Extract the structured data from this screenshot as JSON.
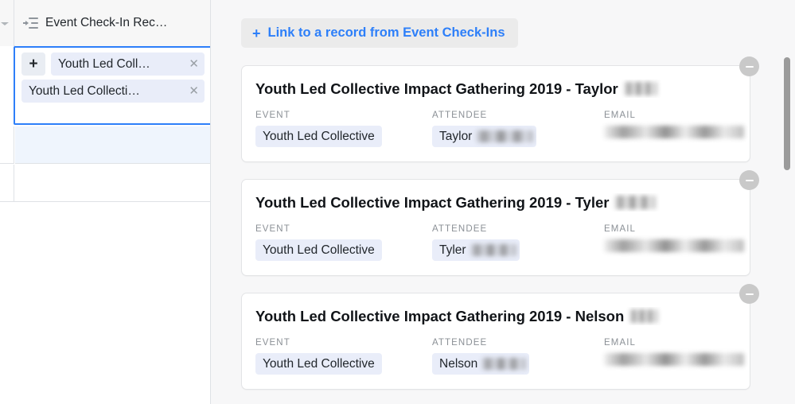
{
  "grid": {
    "column_header": {
      "icon": "linked-record-icon",
      "label": "Event Check-In Rec…"
    },
    "gutter_icon": "chevron-down-icon",
    "selected_cell": {
      "add_button_label": "+",
      "tokens": [
        {
          "label": "Youth Led Coll…",
          "remove_label": "✕"
        },
        {
          "label": "Youth Led Collecti…",
          "remove_label": "✕"
        }
      ]
    }
  },
  "detail": {
    "link_button": {
      "plus": "+",
      "label": "Link to a record from Event Check-Ins"
    },
    "field_labels": {
      "event": "EVENT",
      "attendee": "ATTENDEE",
      "email": "EMAIL"
    },
    "remove_icon_label": "−",
    "cards": [
      {
        "title_text": "Youth Led Collective Impact Gathering 2019 - Taylor",
        "title_redacted": true,
        "title_redaction_width": 42,
        "event": "Youth Led Collective",
        "attendee_text": "Taylor",
        "attendee_redaction_width": 72,
        "email_redacted": true,
        "email_redaction_width": 176
      },
      {
        "title_text": "Youth Led Collective Impact Gathering 2019 - Tyler",
        "title_redacted": true,
        "title_redaction_width": 52,
        "event": "Youth Led Collective",
        "attendee_text": "Tyler",
        "attendee_redaction_width": 58,
        "email_redacted": true,
        "email_redaction_width": 176
      },
      {
        "title_text": "Youth Led Collective Impact Gathering 2019 - Nelson",
        "title_redacted": true,
        "title_redaction_width": 36,
        "event": "Youth Led Collective",
        "attendee_text": "Nelson",
        "attendee_redaction_width": 56,
        "email_redacted": true,
        "email_redaction_width": 176
      }
    ],
    "scrollbar": {
      "name": "vertical-scrollbar"
    }
  },
  "colors": {
    "accent_blue": "#2d7ff9",
    "token_bg": "#e9edf9",
    "panel_bg": "#f7f7f8",
    "card_border": "#e3e4e6",
    "row_highlight": "#eff5fd"
  }
}
